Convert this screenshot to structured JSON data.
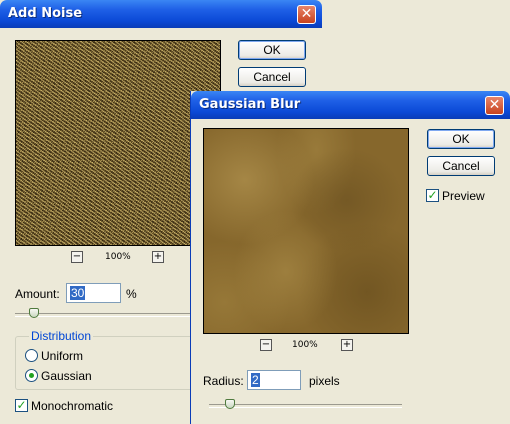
{
  "add_noise": {
    "title": "Add Noise",
    "close_glyph": "✕",
    "ok_label": "OK",
    "cancel_label": "Cancel",
    "zoom_minus": "−",
    "zoom_plus": "+",
    "zoom_level": "100%",
    "amount_label": "Amount:",
    "amount_value": "30",
    "amount_unit": "%",
    "distribution_label": "Distribution",
    "uniform_label": "Uniform",
    "gaussian_label": "Gaussian",
    "selected_distribution": "Gaussian",
    "monochromatic_label": "Monochromatic",
    "monochromatic_checked": true
  },
  "gaussian_blur": {
    "title": "Gaussian Blur",
    "close_glyph": "✕",
    "ok_label": "OK",
    "cancel_label": "Cancel",
    "preview_label": "Preview",
    "preview_checked": true,
    "zoom_minus": "−",
    "zoom_plus": "+",
    "zoom_level": "100%",
    "radius_label": "Radius:",
    "radius_value": "2",
    "radius_unit": "pixels"
  },
  "colors": {
    "titlebar_blue": "#0B49D6",
    "dialog_bg": "#ECE9D8",
    "close_red": "#C8431F",
    "group_legend": "#0046D5",
    "selection": "#316AC5"
  }
}
